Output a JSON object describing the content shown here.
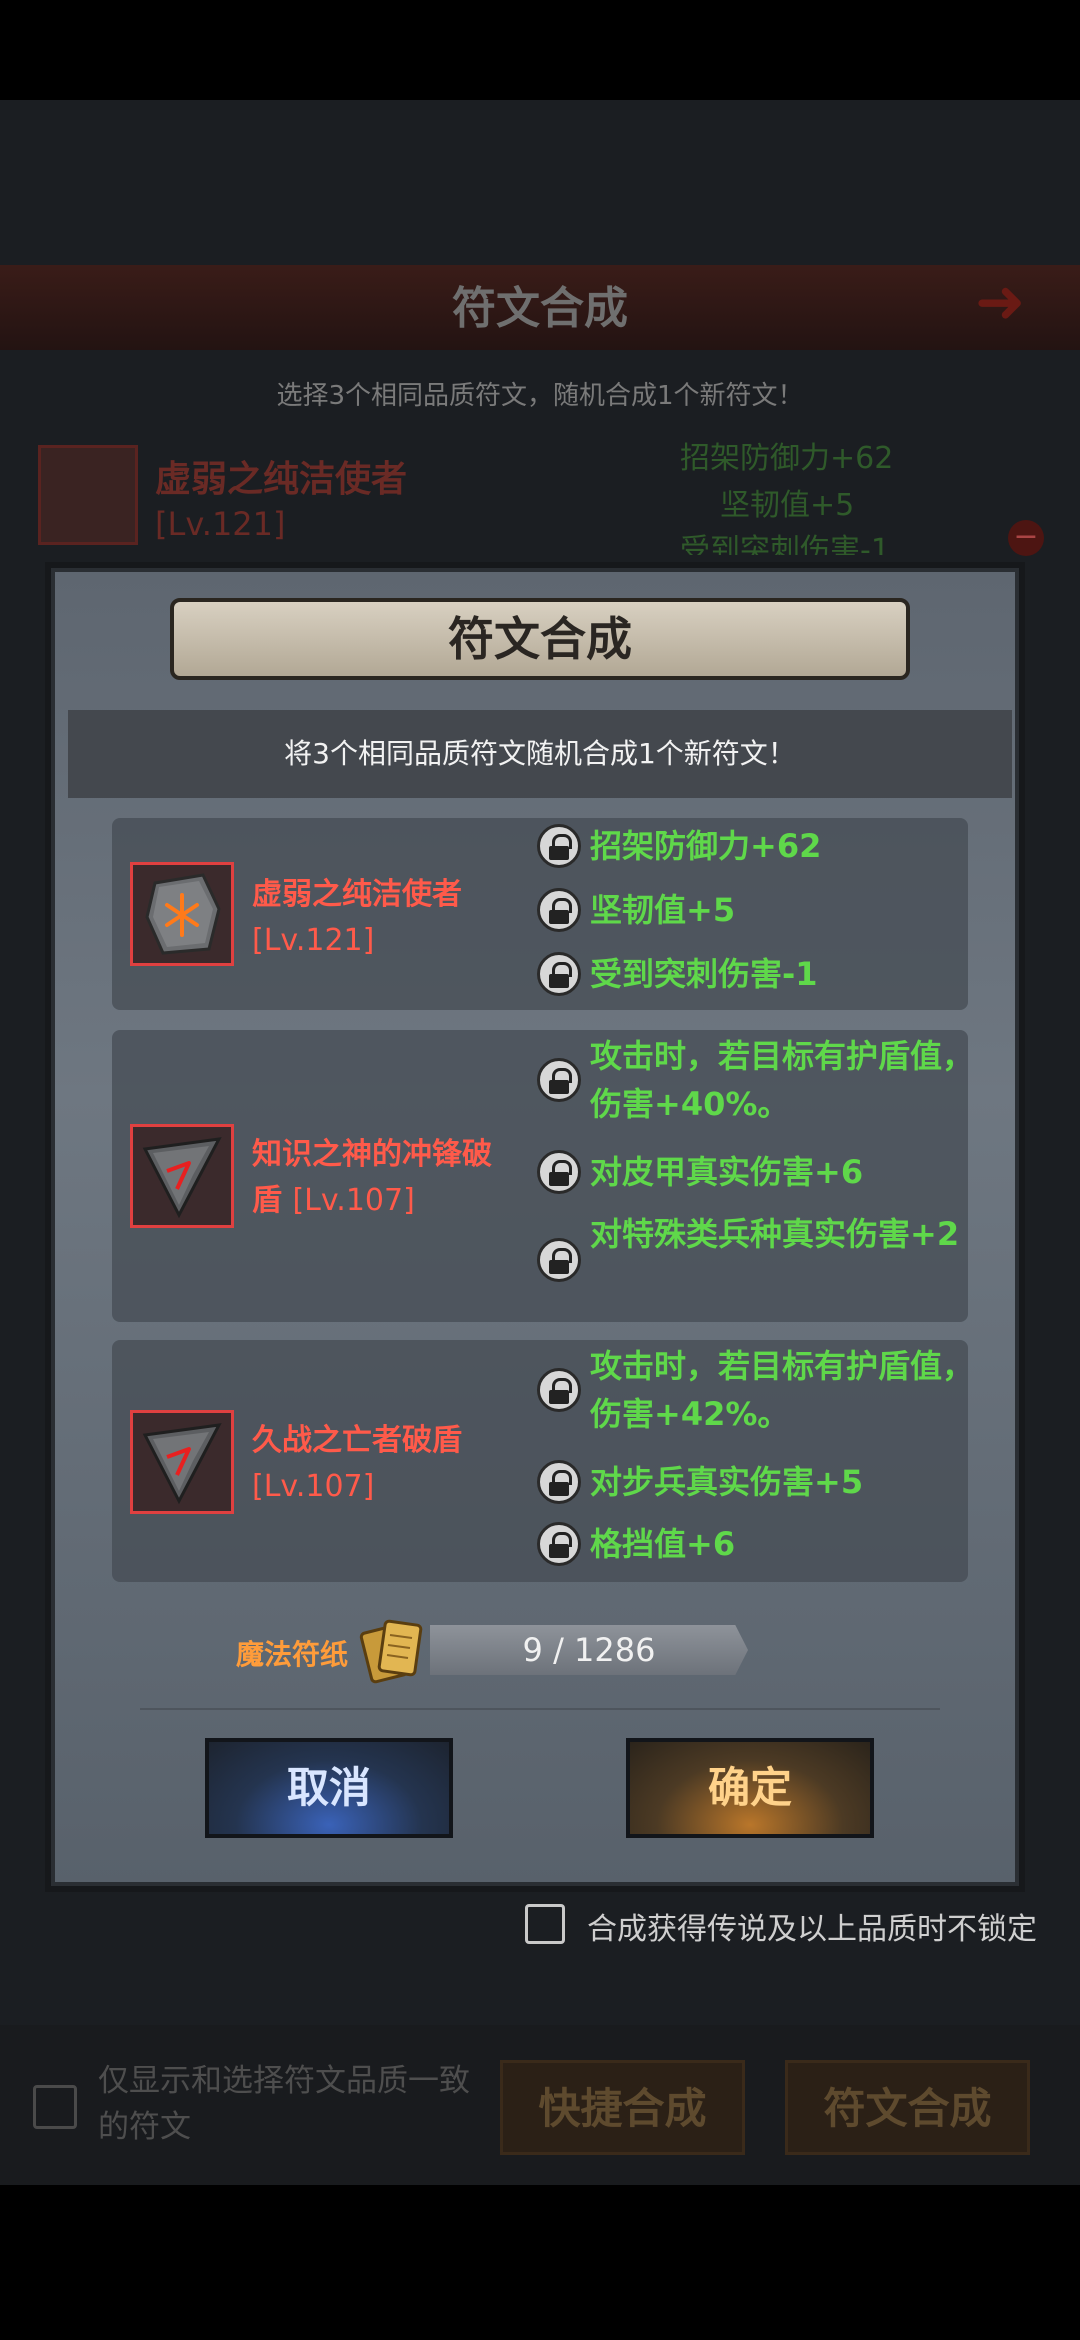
{
  "background": {
    "title": "符文合成",
    "subtitle": "选择3个相同品质符文，随机合成1个新符文！",
    "selected_rune": {
      "name": "虚弱之纯洁使者",
      "level": "[Lv.121]"
    },
    "stats": [
      "招架防御力+62",
      "坚韧值+5",
      "受到突刺伤害-1"
    ],
    "lock_checkbox_label": "合成获得传说及以上品质时不锁定",
    "filter_label": "仅显示和选择符文品质一致的符文",
    "quick_synth_label": "快捷合成",
    "synth_label": "符文合成"
  },
  "dialog": {
    "title": "符文合成",
    "subtitle": "将3个相同品质符文随机合成1个新符文！",
    "runes": [
      {
        "name": "虚弱之纯洁使者",
        "level": "[Lv.121]",
        "icon": "stone-rune-icon",
        "stats": [
          "招架防御力+62",
          "坚韧值+5",
          "受到突刺伤害-1"
        ]
      },
      {
        "name": "知识之神的冲锋破盾",
        "level": "[Lv.107]",
        "icon": "arrowhead-rune-icon",
        "stats": [
          "攻击时，若目标有护盾值，伤害+40%。",
          "对皮甲真实伤害+6",
          "对特殊类兵种真实伤害+2"
        ]
      },
      {
        "name": "久战之亡者破盾",
        "level": "[Lv.107]",
        "icon": "arrowhead-rune-icon",
        "stats": [
          "攻击时，若目标有护盾值，伤害+42%。",
          "对步兵真实伤害+5",
          "格挡值+6"
        ]
      }
    ],
    "material": {
      "label": "魔法符纸",
      "count": "9 / 1286",
      "icon": "paper-scroll-icon"
    },
    "cancel_label": "取消",
    "confirm_label": "确定"
  },
  "colors": {
    "rune_name": "#ff5a4a",
    "stat_green": "#5fd84a",
    "material_label": "#ff9c3a"
  }
}
